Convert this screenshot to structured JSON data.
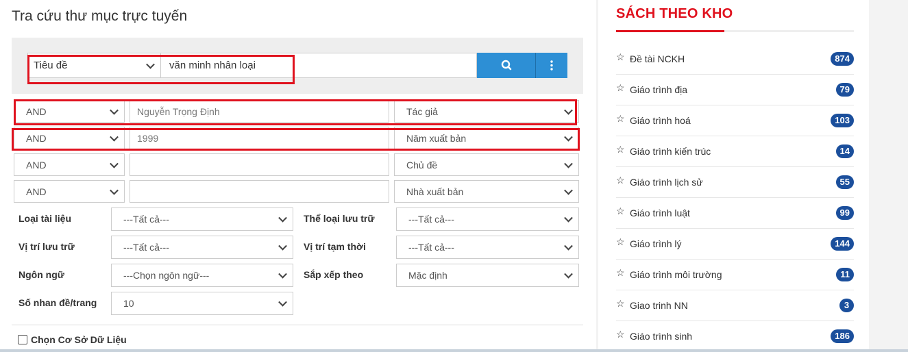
{
  "page_title": "Tra cứu thư mục trực tuyến",
  "search": {
    "field_select": "Tiêu đề",
    "query": "văn minh nhân loại",
    "search_icon": "search-icon",
    "more_icon": "vertical-dots-icon",
    "accent": "#2d8fd5"
  },
  "advanced_rows": [
    {
      "op": "AND",
      "value": "Nguyễn Trọng Định",
      "field": "Tác giả"
    },
    {
      "op": "AND",
      "value": "1999",
      "field": "Năm xuất bản"
    },
    {
      "op": "AND",
      "value": "",
      "field": "Chủ đề"
    },
    {
      "op": "AND",
      "value": "",
      "field": "Nhà xuất bản"
    }
  ],
  "filters": {
    "loai_tai_lieu": {
      "label": "Loại tài liệu",
      "value": "---Tất cả---"
    },
    "the_loai_luu_tru": {
      "label": "Thể loại lưu trữ",
      "value": "---Tất cả---"
    },
    "vi_tri_luu_tru": {
      "label": "Vị trí lưu trữ",
      "value": "---Tất cả---"
    },
    "vi_tri_tam_thoi": {
      "label": "Vị trí tạm thời",
      "value": "---Tất cả---"
    },
    "ngon_ngu": {
      "label": "Ngôn ngữ",
      "value": "---Chọn ngôn ngữ---"
    },
    "sap_xep_theo": {
      "label": "Sắp xếp theo",
      "value": "Mặc định"
    },
    "so_nhan_de": {
      "label": "Số nhan đề/trang",
      "value": "10"
    }
  },
  "database_checkbox_label": "Chọn Cơ Sở Dữ Liệu",
  "sidebar": {
    "title": "SÁCH THEO KHO",
    "title_color": "#e0121e",
    "badge_color": "#1b4f9c",
    "items": [
      {
        "label": "Đề tài NCKH",
        "count": "874"
      },
      {
        "label": "Giáo trình địa",
        "count": "79"
      },
      {
        "label": "Giáo trình hoá",
        "count": "103"
      },
      {
        "label": "Giáo trình kiến trúc",
        "count": "14"
      },
      {
        "label": "Giáo trình lịch sử",
        "count": "55"
      },
      {
        "label": "Giáo trình luật",
        "count": "99"
      },
      {
        "label": "Giáo trình lý",
        "count": "144"
      },
      {
        "label": "Giáo trình môi trường",
        "count": "11"
      },
      {
        "label": "Giao trinh NN",
        "count": "3"
      },
      {
        "label": "Giáo trình sinh",
        "count": "186"
      }
    ]
  },
  "highlight_color": "#e0121e"
}
